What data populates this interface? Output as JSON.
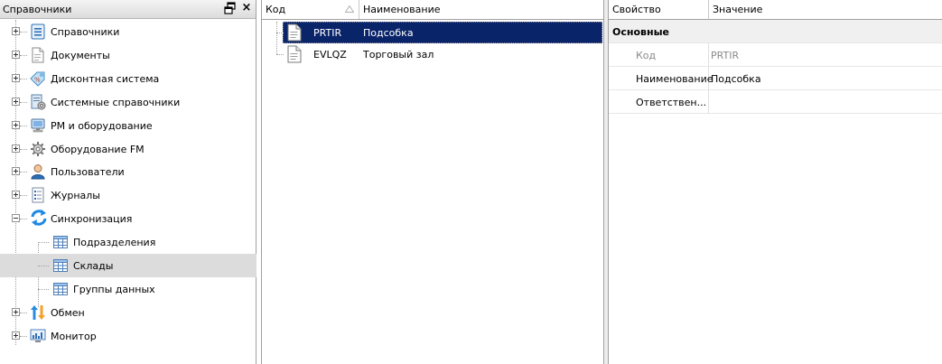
{
  "left_panel": {
    "title": "Справочники",
    "pin_icon": "pin-window-icon",
    "close_label": "×",
    "items": [
      {
        "label": "Справочники",
        "icon": "list-icon",
        "expander": "plus"
      },
      {
        "label": "Документы",
        "icon": "document-icon",
        "expander": "plus"
      },
      {
        "label": "Дисконтная система",
        "icon": "discount-tag-icon",
        "expander": "plus"
      },
      {
        "label": "Системные справочники",
        "icon": "system-catalog-icon",
        "expander": "plus"
      },
      {
        "label": "РМ и оборудование",
        "icon": "workstation-icon",
        "expander": "plus"
      },
      {
        "label": "Оборудование FM",
        "icon": "gear-icon",
        "expander": "plus"
      },
      {
        "label": "Пользователи",
        "icon": "user-icon",
        "expander": "plus"
      },
      {
        "label": "Журналы",
        "icon": "journal-icon",
        "expander": "plus"
      },
      {
        "label": "Синхронизация",
        "icon": "sync-icon",
        "expander": "minus"
      },
      {
        "label": "Подразделения",
        "icon": "table-icon",
        "child": true
      },
      {
        "label": "Склады",
        "icon": "table-icon",
        "child": true,
        "selected": true
      },
      {
        "label": "Группы данных",
        "icon": "table-icon",
        "child": true
      },
      {
        "label": "Обмен",
        "icon": "exchange-arrows-icon",
        "expander": "plus"
      },
      {
        "label": "Монитор",
        "icon": "monitor-chart-icon",
        "expander": "plus"
      }
    ]
  },
  "list": {
    "columns": {
      "code": "Код",
      "name": "Наименование"
    },
    "sort": "ascending",
    "rows": [
      {
        "code": "PRTIR",
        "name": "Подсобка",
        "selected": true
      },
      {
        "code": "EVLQZ",
        "name": "Торговый зал",
        "selected": false
      }
    ]
  },
  "properties": {
    "columns": {
      "property": "Свойство",
      "value": "Значение"
    },
    "category": "Основные",
    "rows": [
      {
        "name": "Код",
        "value": "PRTIR",
        "readonly": true
      },
      {
        "name": "Наименование",
        "value": "Подсобка",
        "readonly": false
      },
      {
        "name": "Ответствен...",
        "value": "",
        "readonly": false
      }
    ]
  },
  "colors": {
    "selection": "#0a246a",
    "tree_selected": "#dcdcdc",
    "sync_blue": "#1e88e5"
  }
}
